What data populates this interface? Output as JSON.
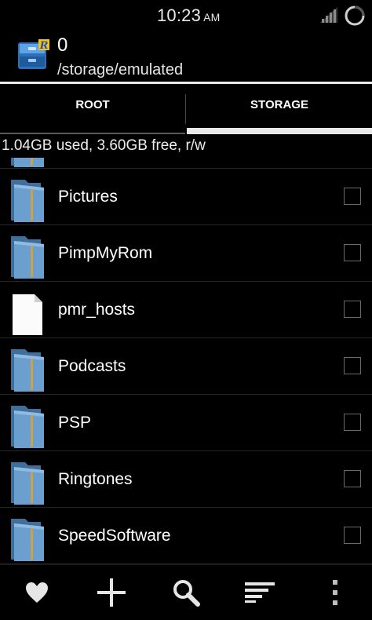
{
  "status_bar": {
    "time": "10:23",
    "ampm": "AM"
  },
  "title_bar": {
    "count": "0",
    "path": "/storage/emulated"
  },
  "tabs": [
    {
      "label": "ROOT",
      "selected": false
    },
    {
      "label": "STORAGE",
      "selected": true
    }
  ],
  "storage_info": "1.04GB used, 3.60GB free, r/w",
  "files": [
    {
      "name": "Pictures",
      "type": "folder",
      "checked": false
    },
    {
      "name": "PimpMyRom",
      "type": "folder",
      "checked": false
    },
    {
      "name": "pmr_hosts",
      "type": "file",
      "checked": false
    },
    {
      "name": "Podcasts",
      "type": "folder",
      "checked": false
    },
    {
      "name": "PSP",
      "type": "folder",
      "checked": false
    },
    {
      "name": "Ringtones",
      "type": "folder",
      "checked": false
    },
    {
      "name": "SpeedSoftware",
      "type": "folder",
      "checked": false
    }
  ],
  "bottom_actions": [
    "heart-icon",
    "plus-icon",
    "search-icon",
    "sort-icon",
    "overflow-menu-icon"
  ],
  "colors": {
    "background": "#000000",
    "text": "#ffffff",
    "folder_blue": "#5f93c4",
    "tab_indicator": "#e9e9e9"
  }
}
